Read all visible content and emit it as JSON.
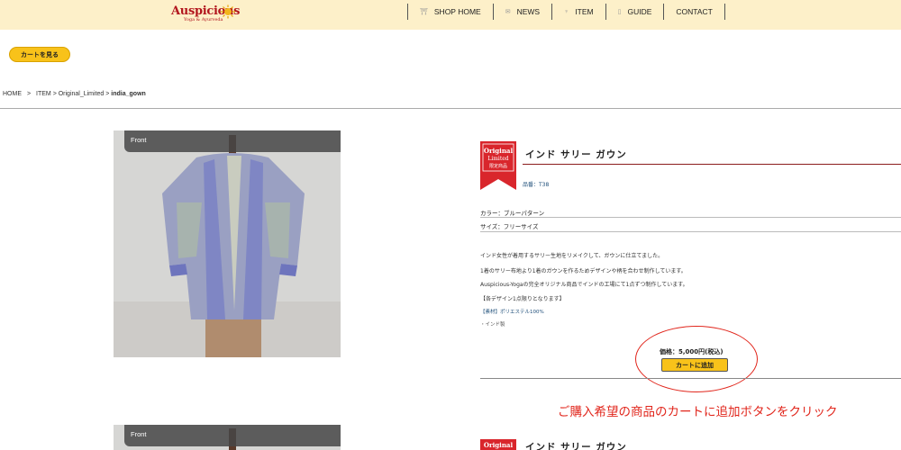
{
  "header": {
    "logo_text": "Auspicious",
    "logo_sub": "Yoga & Ayurveda",
    "nav": [
      {
        "label": "SHOP HOME",
        "icon": "shop-icon"
      },
      {
        "label": "NEWS",
        "icon": "news-icon"
      },
      {
        "label": "ITEM",
        "icon": "item-icon"
      },
      {
        "label": "GUIDE",
        "icon": "guide-icon"
      },
      {
        "label": "CONTACT",
        "icon": ""
      }
    ]
  },
  "cart_view_label": "カートを見る",
  "breadcrumb": {
    "home": "HOME",
    "sep": ">",
    "item": "ITEM",
    "category": "> Original_Limited >",
    "current": "india_gown"
  },
  "products": [
    {
      "photo_label": "Front",
      "badge": {
        "line1": "Original",
        "line2": "Limited",
        "line3": "限定商品"
      },
      "title": "インド サリー ガウン",
      "sku": "品番：T38",
      "color": "カラー：ブルーパターン",
      "size": "サイズ：フリーサイズ",
      "description": [
        "インド女性が着用するサリー生地をリメイクして、ガウンに仕立てました。",
        "1着のサリー布地より1着のガウンを作るためデザインや柄を合わせ制作しています。",
        "Auspicious-Yogaの完全オリジナル商品でインドの工場にて1点ずつ制作しています。",
        "【各デザイン1点限りとなります】",
        "【素材】ポリエステル100%",
        "・インド製"
      ],
      "price": "価格：5,000円(税込)",
      "add_to_cart": "カートに追加"
    },
    {
      "photo_label": "Front",
      "badge": {
        "line1": "Original"
      },
      "title": "インド サリー ガウン"
    }
  ],
  "annotation": "ご購入希望の商品のカートに追加ボタンをクリック",
  "colors": {
    "header_bg": "#fdf0c9",
    "button_yellow": "#f8c21a",
    "badge_red": "#d9262c",
    "annotation_red": "#e1261c",
    "title_rule": "#8b1d1d"
  }
}
